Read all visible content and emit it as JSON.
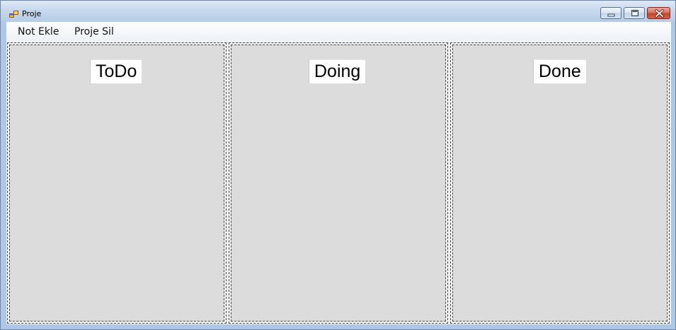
{
  "window": {
    "title": "Proje",
    "icon": "app-window-icon"
  },
  "caption_buttons": {
    "minimize": "minimize-icon",
    "maximize": "restore-icon",
    "close": "close-icon"
  },
  "menu": {
    "items": [
      {
        "label": "Not Ekle"
      },
      {
        "label": "Proje Sil"
      }
    ]
  },
  "board": {
    "columns": [
      {
        "label": "ToDo"
      },
      {
        "label": "Doing"
      },
      {
        "label": "Done"
      }
    ]
  },
  "colors": {
    "panel_background": "#dcdcdc",
    "titlebar": "#c7d8ee",
    "close_button": "#c6442c"
  }
}
